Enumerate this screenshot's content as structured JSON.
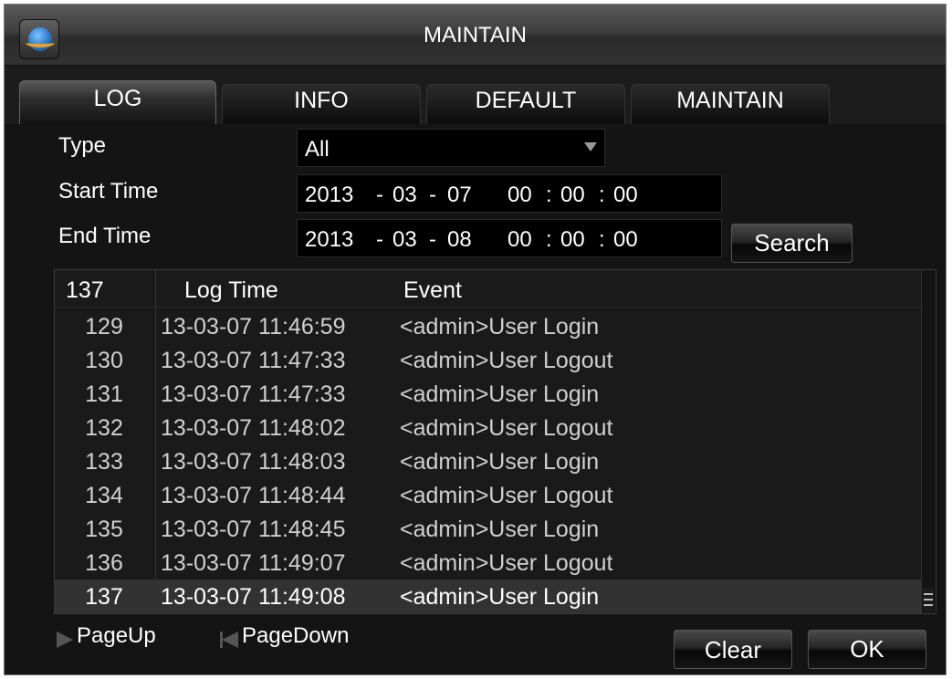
{
  "window": {
    "title": "MAINTAIN",
    "icon": "globe-app-icon"
  },
  "tabs": [
    {
      "label": "LOG",
      "active": true
    },
    {
      "label": "INFO",
      "active": false
    },
    {
      "label": "DEFAULT",
      "active": false
    },
    {
      "label": "MAINTAIN",
      "active": false
    }
  ],
  "filters": {
    "type_label": "Type",
    "type_value": "All",
    "start_label": "Start Time",
    "start": {
      "year": "2013",
      "month": "03",
      "day": "07",
      "hour": "00",
      "minute": "00",
      "second": "00"
    },
    "end_label": "End Time",
    "end": {
      "year": "2013",
      "month": "03",
      "day": "08",
      "hour": "00",
      "minute": "00",
      "second": "00"
    },
    "date_sep": "-",
    "time_sep": ":",
    "search_label": "Search"
  },
  "log": {
    "total": "137",
    "col_time": "Log Time",
    "col_event": "Event",
    "rows": [
      {
        "num": "129",
        "time": "13-03-07 11:46:59",
        "event": "<admin>User Login"
      },
      {
        "num": "130",
        "time": "13-03-07 11:47:33",
        "event": "<admin>User Logout"
      },
      {
        "num": "131",
        "time": "13-03-07 11:47:33",
        "event": "<admin>User Login"
      },
      {
        "num": "132",
        "time": "13-03-07 11:48:02",
        "event": "<admin>User Logout"
      },
      {
        "num": "133",
        "time": "13-03-07 11:48:03",
        "event": "<admin>User Login"
      },
      {
        "num": "134",
        "time": "13-03-07 11:48:44",
        "event": "<admin>User Logout"
      },
      {
        "num": "135",
        "time": "13-03-07 11:48:45",
        "event": "<admin>User Login"
      },
      {
        "num": "136",
        "time": "13-03-07 11:49:07",
        "event": "<admin>User Logout"
      },
      {
        "num": "137",
        "time": "13-03-07 11:49:08",
        "event": "<admin>User Login",
        "selected": true
      }
    ]
  },
  "pager": {
    "page_up": "PageUp",
    "page_down": "PageDown"
  },
  "actions": {
    "clear_label": "Clear",
    "ok_label": "OK"
  }
}
